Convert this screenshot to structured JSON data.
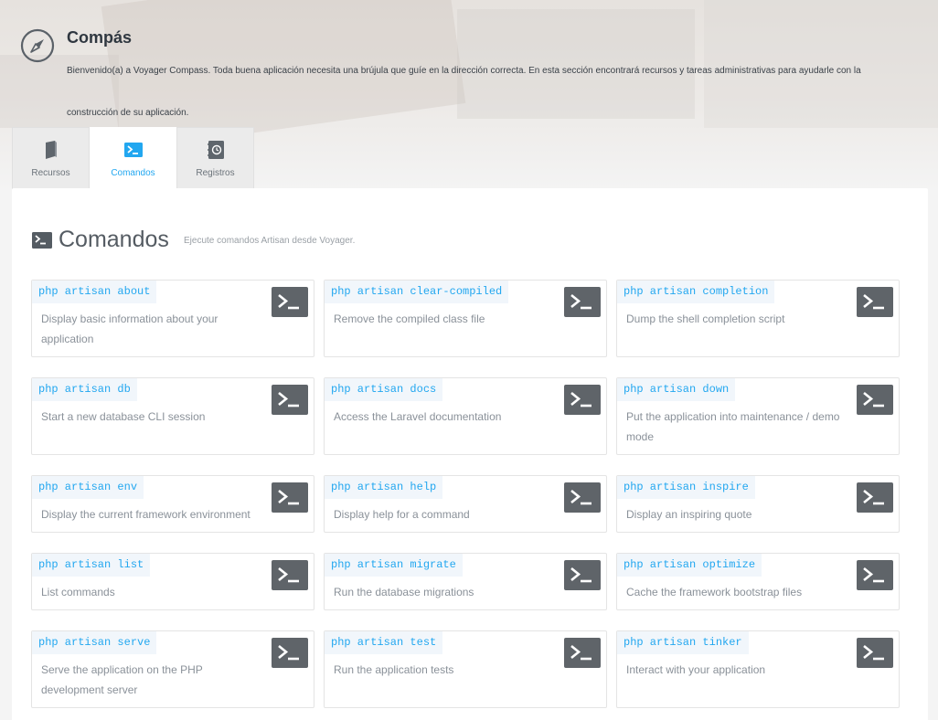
{
  "header": {
    "title": "Compás",
    "description": "Bienvenido(a) a Voyager Compass. Toda buena aplicación necesita una brújula que guíe en la dirección correcta. En esta sección encontrará recursos y tareas administrativas para ayudarle con la construcción de su aplicación."
  },
  "tabs": [
    {
      "label": "Recursos",
      "icon": "book-icon",
      "active": false
    },
    {
      "label": "Comandos",
      "icon": "terminal-icon",
      "active": true
    },
    {
      "label": "Registros",
      "icon": "log-notebook-icon",
      "active": false
    }
  ],
  "section": {
    "title": "Comandos",
    "subtitle": "Ejecute comandos Artisan desde Voyager."
  },
  "commands": [
    {
      "name": "php artisan about",
      "description": "Display basic information about your application"
    },
    {
      "name": "php artisan clear-compiled",
      "description": "Remove the compiled class file"
    },
    {
      "name": "php artisan completion",
      "description": "Dump the shell completion script"
    },
    {
      "name": "php artisan db",
      "description": "Start a new database CLI session"
    },
    {
      "name": "php artisan docs",
      "description": "Access the Laravel documentation"
    },
    {
      "name": "php artisan down",
      "description": "Put the application into maintenance / demo mode"
    },
    {
      "name": "php artisan env",
      "description": "Display the current framework environment"
    },
    {
      "name": "php artisan help",
      "description": "Display help for a command"
    },
    {
      "name": "php artisan inspire",
      "description": "Display an inspiring quote"
    },
    {
      "name": "php artisan list",
      "description": "List commands"
    },
    {
      "name": "php artisan migrate",
      "description": "Run the database migrations"
    },
    {
      "name": "php artisan optimize",
      "description": "Cache the framework bootstrap files"
    },
    {
      "name": "php artisan serve",
      "description": "Serve the application on the PHP development server"
    },
    {
      "name": "php artisan test",
      "description": "Run the application tests"
    },
    {
      "name": "php artisan tinker",
      "description": "Interact with your application"
    }
  ],
  "colors": {
    "accent": "#22a7f0",
    "run_button": "#5f6469",
    "command_bg": "#f1f6fb"
  }
}
